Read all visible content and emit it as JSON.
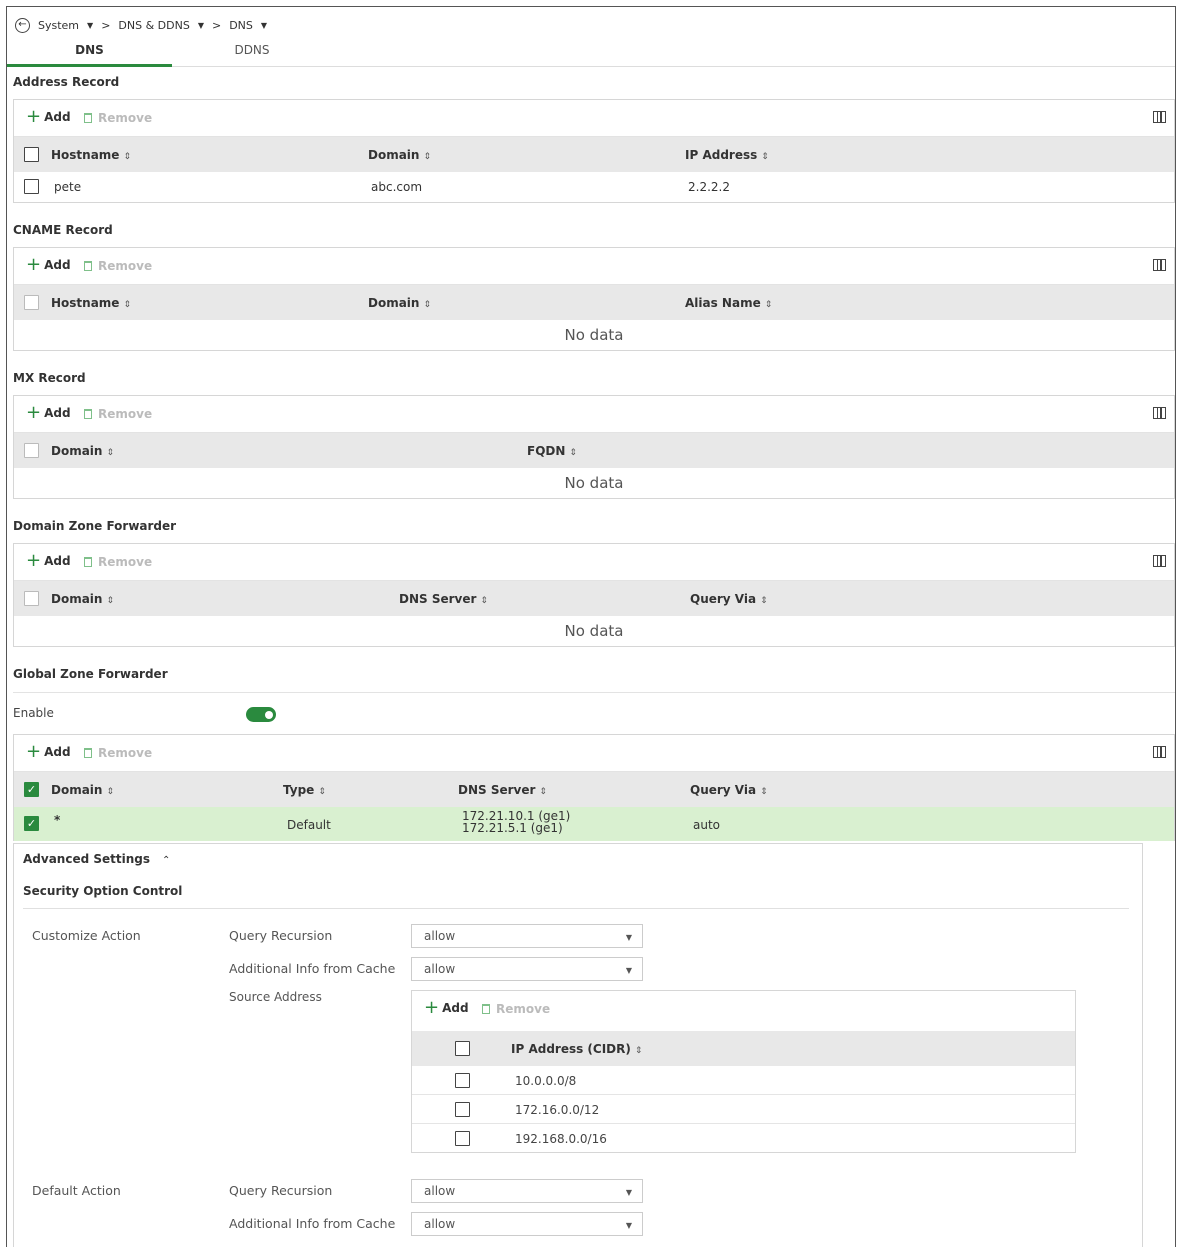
{
  "breadcrumb": {
    "back_icon": "back-arrow-icon",
    "items": [
      "System",
      "DNS & DDNS",
      "DNS"
    ],
    "separator": ">"
  },
  "tabs": [
    {
      "label": "DNS",
      "active": true
    },
    {
      "label": "DDNS",
      "active": false
    }
  ],
  "toolbar": {
    "add_label": "Add",
    "remove_label": "Remove"
  },
  "no_data": "No data",
  "colors": {
    "accent": "#2a8a3e",
    "selected_row": "#d9f0d0",
    "header_bg": "#e8e8e8"
  },
  "address_record": {
    "title": "Address Record",
    "columns": [
      "Hostname",
      "Domain",
      "IP Address"
    ],
    "rows": [
      {
        "hostname": "pete",
        "domain": "abc.com",
        "ip": "2.2.2.2"
      }
    ]
  },
  "cname_record": {
    "title": "CNAME Record",
    "columns": [
      "Hostname",
      "Domain",
      "Alias Name"
    ]
  },
  "mx_record": {
    "title": "MX Record",
    "columns": [
      "Domain",
      "FQDN"
    ]
  },
  "domain_zone_forwarder": {
    "title": "Domain Zone Forwarder",
    "columns": [
      "Domain",
      "DNS Server",
      "Query Via"
    ]
  },
  "global_zone_forwarder": {
    "title": "Global Zone Forwarder",
    "enable_label": "Enable",
    "enabled": true,
    "columns": [
      "Domain",
      "Type",
      "DNS Server",
      "Query Via"
    ],
    "rows": [
      {
        "domain": "*",
        "type": "Default",
        "dns_server_1": "172.21.10.1 (ge1)",
        "dns_server_2": "172.21.5.1 (ge1)",
        "query_via": "auto",
        "checked": true
      }
    ]
  },
  "advanced": {
    "title": "Advanced Settings",
    "security_title": "Security Option Control",
    "customize": {
      "label": "Customize Action",
      "query_recursion_label": "Query Recursion",
      "query_recursion_value": "allow",
      "additional_label": "Additional Info from Cache",
      "additional_value": "allow",
      "source_label": "Source Address",
      "source_column": "IP Address (CIDR)",
      "sources": [
        "10.0.0.0/8",
        "172.16.0.0/12",
        "192.168.0.0/16"
      ]
    },
    "default": {
      "label": "Default Action",
      "query_recursion_label": "Query Recursion",
      "query_recursion_value": "allow",
      "additional_label": "Additional Info from Cache",
      "additional_value": "allow"
    }
  }
}
